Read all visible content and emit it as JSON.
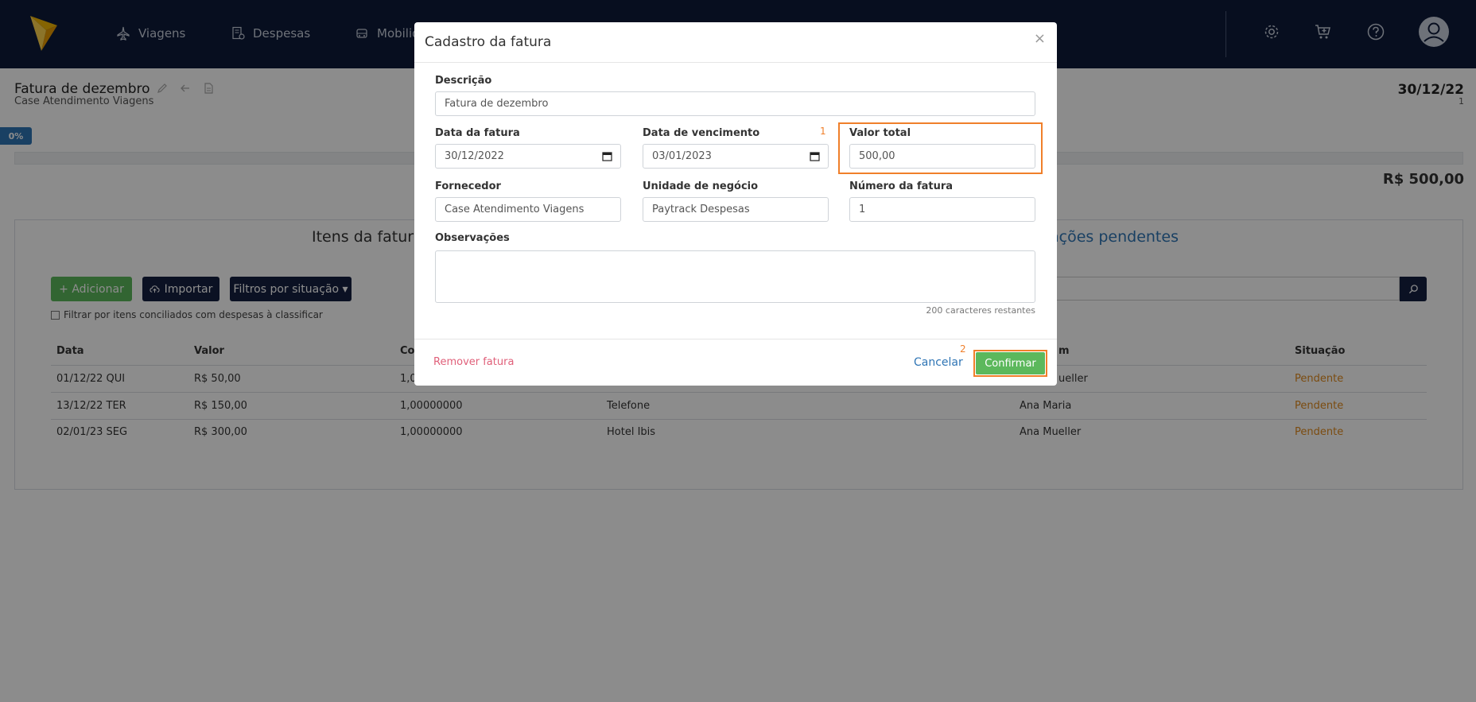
{
  "colors": {
    "nav_bg": "#0d1a3a",
    "accent_blue": "#2f75b5",
    "green": "#5cb85c",
    "highlight_orange": "#f07f2a",
    "pending": "#e08a1e"
  },
  "nav": {
    "items": [
      {
        "label": "Viagens",
        "icon": "plane-icon"
      },
      {
        "label": "Despesas",
        "icon": "receipt-icon"
      },
      {
        "label": "Mobilid",
        "icon": "car-icon"
      }
    ],
    "right_icons": [
      "gear-icon",
      "cart-icon",
      "help-icon",
      "user-icon"
    ]
  },
  "page": {
    "title": "Fatura de dezembro",
    "subtitle": "Case Atendimento Viagens",
    "date": "30/12/22",
    "number": "1",
    "progress": {
      "label": "0%",
      "percent": 0
    },
    "total": "R$ 500,00"
  },
  "panel": {
    "tab_items": "Itens da fatura",
    "tab_pending": "ações pendentes",
    "add_label": "+ Adicionar",
    "import_label": "Importar",
    "filter_label": "Filtros por situação ▾",
    "checkbox_label": "Filtrar por itens conciliados com despesas à classificar",
    "columns": [
      "Data",
      "Valor",
      "Co",
      "m",
      "Situação"
    ],
    "rows": [
      {
        "date": "01/12/22 QUI",
        "value": "R$ 50,00",
        "col3": "1,0",
        "desc": "",
        "person": "ueller",
        "status": "Pendente"
      },
      {
        "date": "13/12/22 TER",
        "value": "R$ 150,00",
        "col3": "1,00000000",
        "desc": "Telefone",
        "person": "Ana Maria",
        "status": "Pendente"
      },
      {
        "date": "02/01/23 SEG",
        "value": "R$ 300,00",
        "col3": "1,00000000",
        "desc": "Hotel Ibis",
        "person": "Ana Mueller",
        "status": "Pendente"
      }
    ]
  },
  "modal": {
    "title": "Cadastro da fatura",
    "close": "×",
    "description_label": "Descrição",
    "description_value": "Fatura de dezembro",
    "invoice_date_label": "Data da fatura",
    "invoice_date_value": "30/12/2022",
    "due_date_label": "Data de vencimento",
    "due_date_value": "03/01/2023",
    "total_label": "Valor total",
    "total_value": "500,00",
    "supplier_label": "Fornecedor",
    "supplier_value": "Case Atendimento Viagens",
    "business_unit_label": "Unidade de negócio",
    "business_unit_value": "Paytrack Despesas",
    "invoice_number_label": "Número da fatura",
    "invoice_number_value": "1",
    "notes_label": "Observações",
    "chars_left": "200 caracteres restantes",
    "remove_label": "Remover fatura",
    "cancel_label": "Cancelar",
    "confirm_label": "Confirmar",
    "step_1": "1",
    "step_2": "2"
  }
}
